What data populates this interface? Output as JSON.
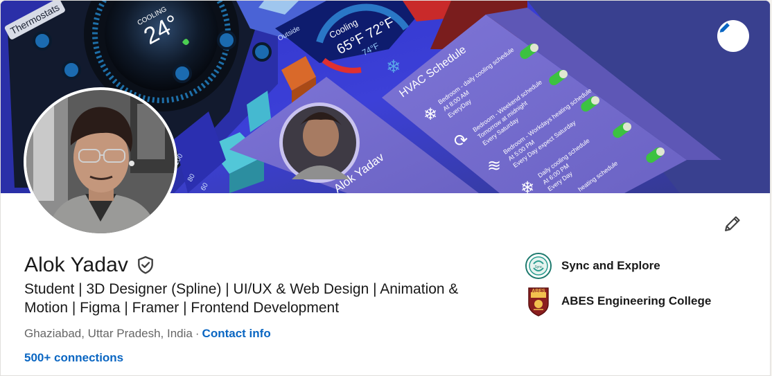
{
  "profile": {
    "name": "Alok Yadav",
    "headline": "Student | 3D Designer (Spline) | UI/UX & Web Design | Animation & Motion | Figma | Framer | Frontend Development",
    "location": "Ghaziabad, Uttar Pradesh, India",
    "location_separator": "·",
    "contact_info": "Contact info",
    "connections": "500+ connections"
  },
  "organizations": [
    {
      "name": "Sync and Explore",
      "logo_text": "Sync and Explore"
    },
    {
      "name": "ABES Engineering College",
      "logo_text": "ABES"
    }
  ],
  "banner": {
    "thermostat_label": "Thermostats",
    "cooling_label": "COOLING",
    "temperature": "24°",
    "outside_label": "Outside",
    "cooling_card_label": "Cooling",
    "cooling_temps": "65°F  72°F",
    "cooling_current": "74°F",
    "schedule_title": "HVAC Schedule",
    "schedule_items": [
      {
        "title": "Bedroom - daily cooling schedule",
        "time": "At 8:00 AM",
        "repeat": "EveryDay"
      },
      {
        "title": "Bedroom - Weekend schedule",
        "time": "Tomorrow at midnight",
        "repeat": "Every Saturday"
      },
      {
        "title": "Bedroom - Workdays heating schedule",
        "time": "At 5:00 PM",
        "repeat": "Every Day expect Saturday"
      },
      {
        "title": "Daily cooling schedule",
        "time": "At 6:00 PM",
        "repeat": "Every Day"
      },
      {
        "title": "heating schedule",
        "time": "",
        "repeat": ""
      }
    ],
    "card_name": "Alok Yadav",
    "scale": [
      "100",
      "80",
      "60"
    ]
  },
  "icons": {
    "banner_edit": "pencil-icon",
    "profile_edit": "pencil-icon",
    "verified": "shield-check-icon"
  },
  "colors": {
    "link": "#0a66c2",
    "text": "#191919",
    "muted": "#666666",
    "banner_bg": "#3b3fb3"
  }
}
